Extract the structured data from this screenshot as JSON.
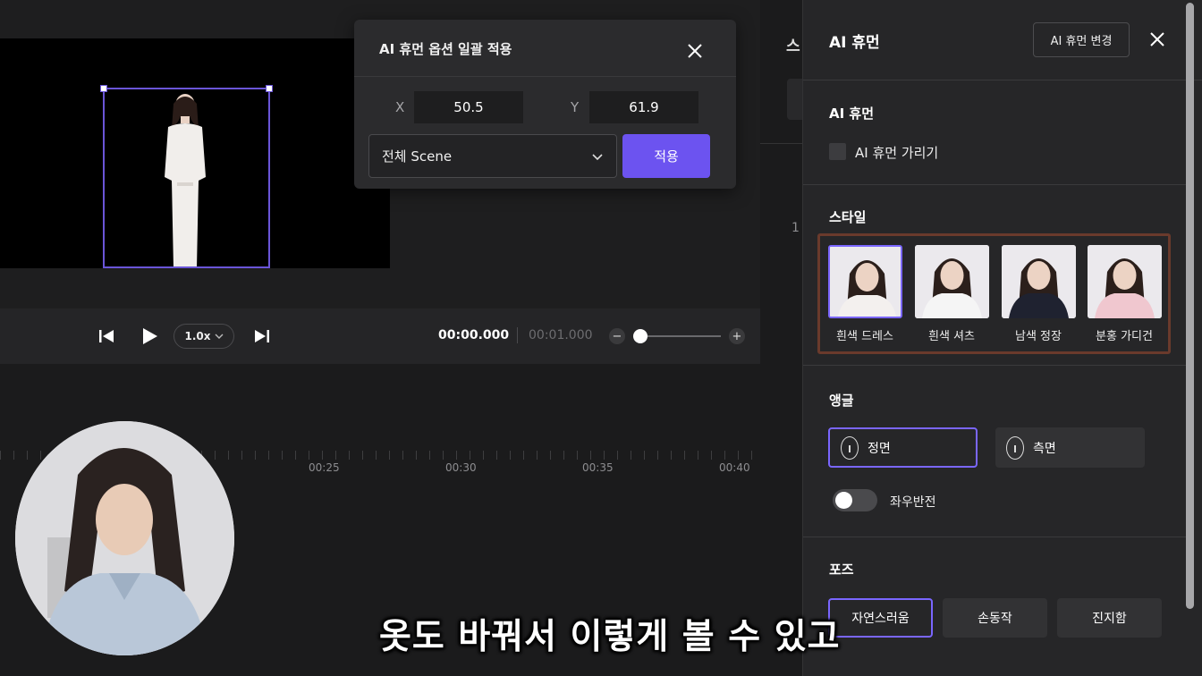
{
  "popover": {
    "title": "AI 휴먼 옵션 일괄 적용",
    "x_label": "X",
    "x_value": "50.5",
    "y_label": "Y",
    "y_value": "61.9",
    "scene_option": "전체 Scene",
    "apply_label": "적용"
  },
  "playback": {
    "speed": "1.0x",
    "current_time": "00:00.000",
    "total_time": "00:01.000"
  },
  "timeline": {
    "ticks": [
      "00:25",
      "00:30",
      "00:35",
      "00:40"
    ]
  },
  "middle": {
    "partial_title": "스",
    "row_number": "1"
  },
  "panel": {
    "title": "AI 휴먼",
    "change_button": "AI 휴먼 변경",
    "section_ai_human": "AI 휴먼",
    "hide_label": "AI 휴먼 가리기",
    "section_style": "스타일",
    "styles": [
      {
        "label": "흰색 드레스",
        "selected": true,
        "outfit": "#f3f0ee"
      },
      {
        "label": "흰색 셔츠",
        "selected": false,
        "outfit": "#f5f5f5"
      },
      {
        "label": "남색 정장",
        "selected": false,
        "outfit": "#1f2230"
      },
      {
        "label": "분홍 가디건",
        "selected": false,
        "outfit": "#f0c7cf"
      }
    ],
    "section_angle": "앵글",
    "angles": [
      {
        "label": "정면",
        "selected": true
      },
      {
        "label": "측면",
        "selected": false
      }
    ],
    "flip_label": "좌우반전",
    "flip_on": false,
    "section_pose": "포즈",
    "poses": [
      {
        "label": "자연스러움",
        "selected": true
      },
      {
        "label": "손동작",
        "selected": false
      },
      {
        "label": "진지함",
        "selected": false
      }
    ]
  },
  "caption": "옷도 바꿔서 이렇게 볼 수 있고",
  "colors": {
    "accent": "#6c53f0",
    "selection": "#7a66ff",
    "panel_bg": "#262628"
  }
}
